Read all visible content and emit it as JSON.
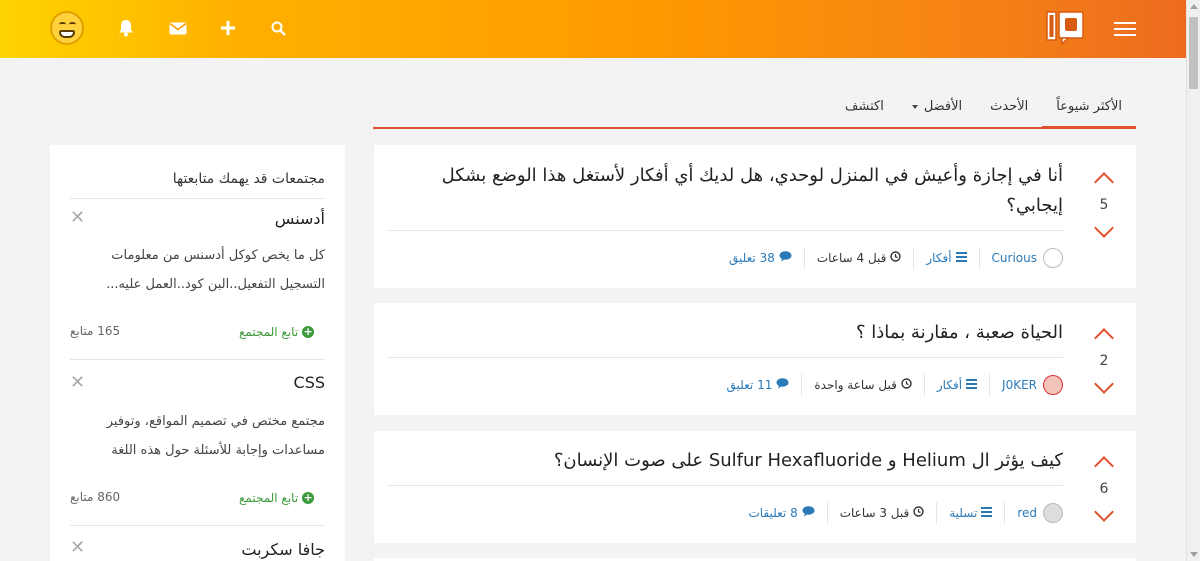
{
  "header": {
    "icons": [
      "notification-bell-icon",
      "messages-envelope-icon",
      "add-plus-icon",
      "search-icon"
    ],
    "logo": "io-logo",
    "menu_icon": "hamburger-icon",
    "avatar": "smiley-avatar"
  },
  "tabs": [
    {
      "label": "الأكثر شيوعاً",
      "active": true
    },
    {
      "label": "الأحدث",
      "active": false
    },
    {
      "label": "الأفضل",
      "active": false,
      "dropdown": true
    },
    {
      "label": "اكتشف",
      "active": false
    }
  ],
  "posts": [
    {
      "title": "أنا في إجازة وأعيش في المنزل لوحدي، هل لديك أي أفكار لأستغل هذا الوضع بشكل إيجابي؟",
      "votes": "5",
      "user": "Curious",
      "category": "أفكار",
      "time": "قبل 4 ساعات",
      "comments": "38 تعليق"
    },
    {
      "title": "الحياة صعبة ، مقارنة بماذا ؟",
      "votes": "2",
      "user": "J0KER",
      "category": "أفكار",
      "time": "قبل ساعة واحدة",
      "comments": "11 تعليق"
    },
    {
      "title": "كيف يؤثر ال Helium و Sulfur Hexafluoride على صوت الإنسان؟",
      "votes": "6",
      "user": "red",
      "category": "تسلية",
      "time": "قبل 3 ساعات",
      "comments": "8 تعليقات"
    }
  ],
  "sidebar": {
    "title": "مجتمعات قد يهمك متابعتها",
    "communities": [
      {
        "name": "أدسنس",
        "description_line1": "كل ما يخص كوكل أدسنس من معلومات",
        "description_line2": "التسجيل التفعيل..البن كود..العمل عليه...",
        "follow_label": "تابع المجتمع",
        "followers": "165 متابع"
      },
      {
        "name": "CSS",
        "description_line1": "مجتمع مختص في تصميم المواقع، وتوفير",
        "description_line2": "مساعدات وإجابة للأسئلة حول هذه اللغة",
        "follow_label": "تابع المجتمع",
        "followers": "860 متابع"
      },
      {
        "name": "جافا سكربت"
      }
    ]
  },
  "colors": {
    "accent": "#e0502c",
    "link": "#2a7ab8",
    "follow": "#3c9a3c"
  }
}
